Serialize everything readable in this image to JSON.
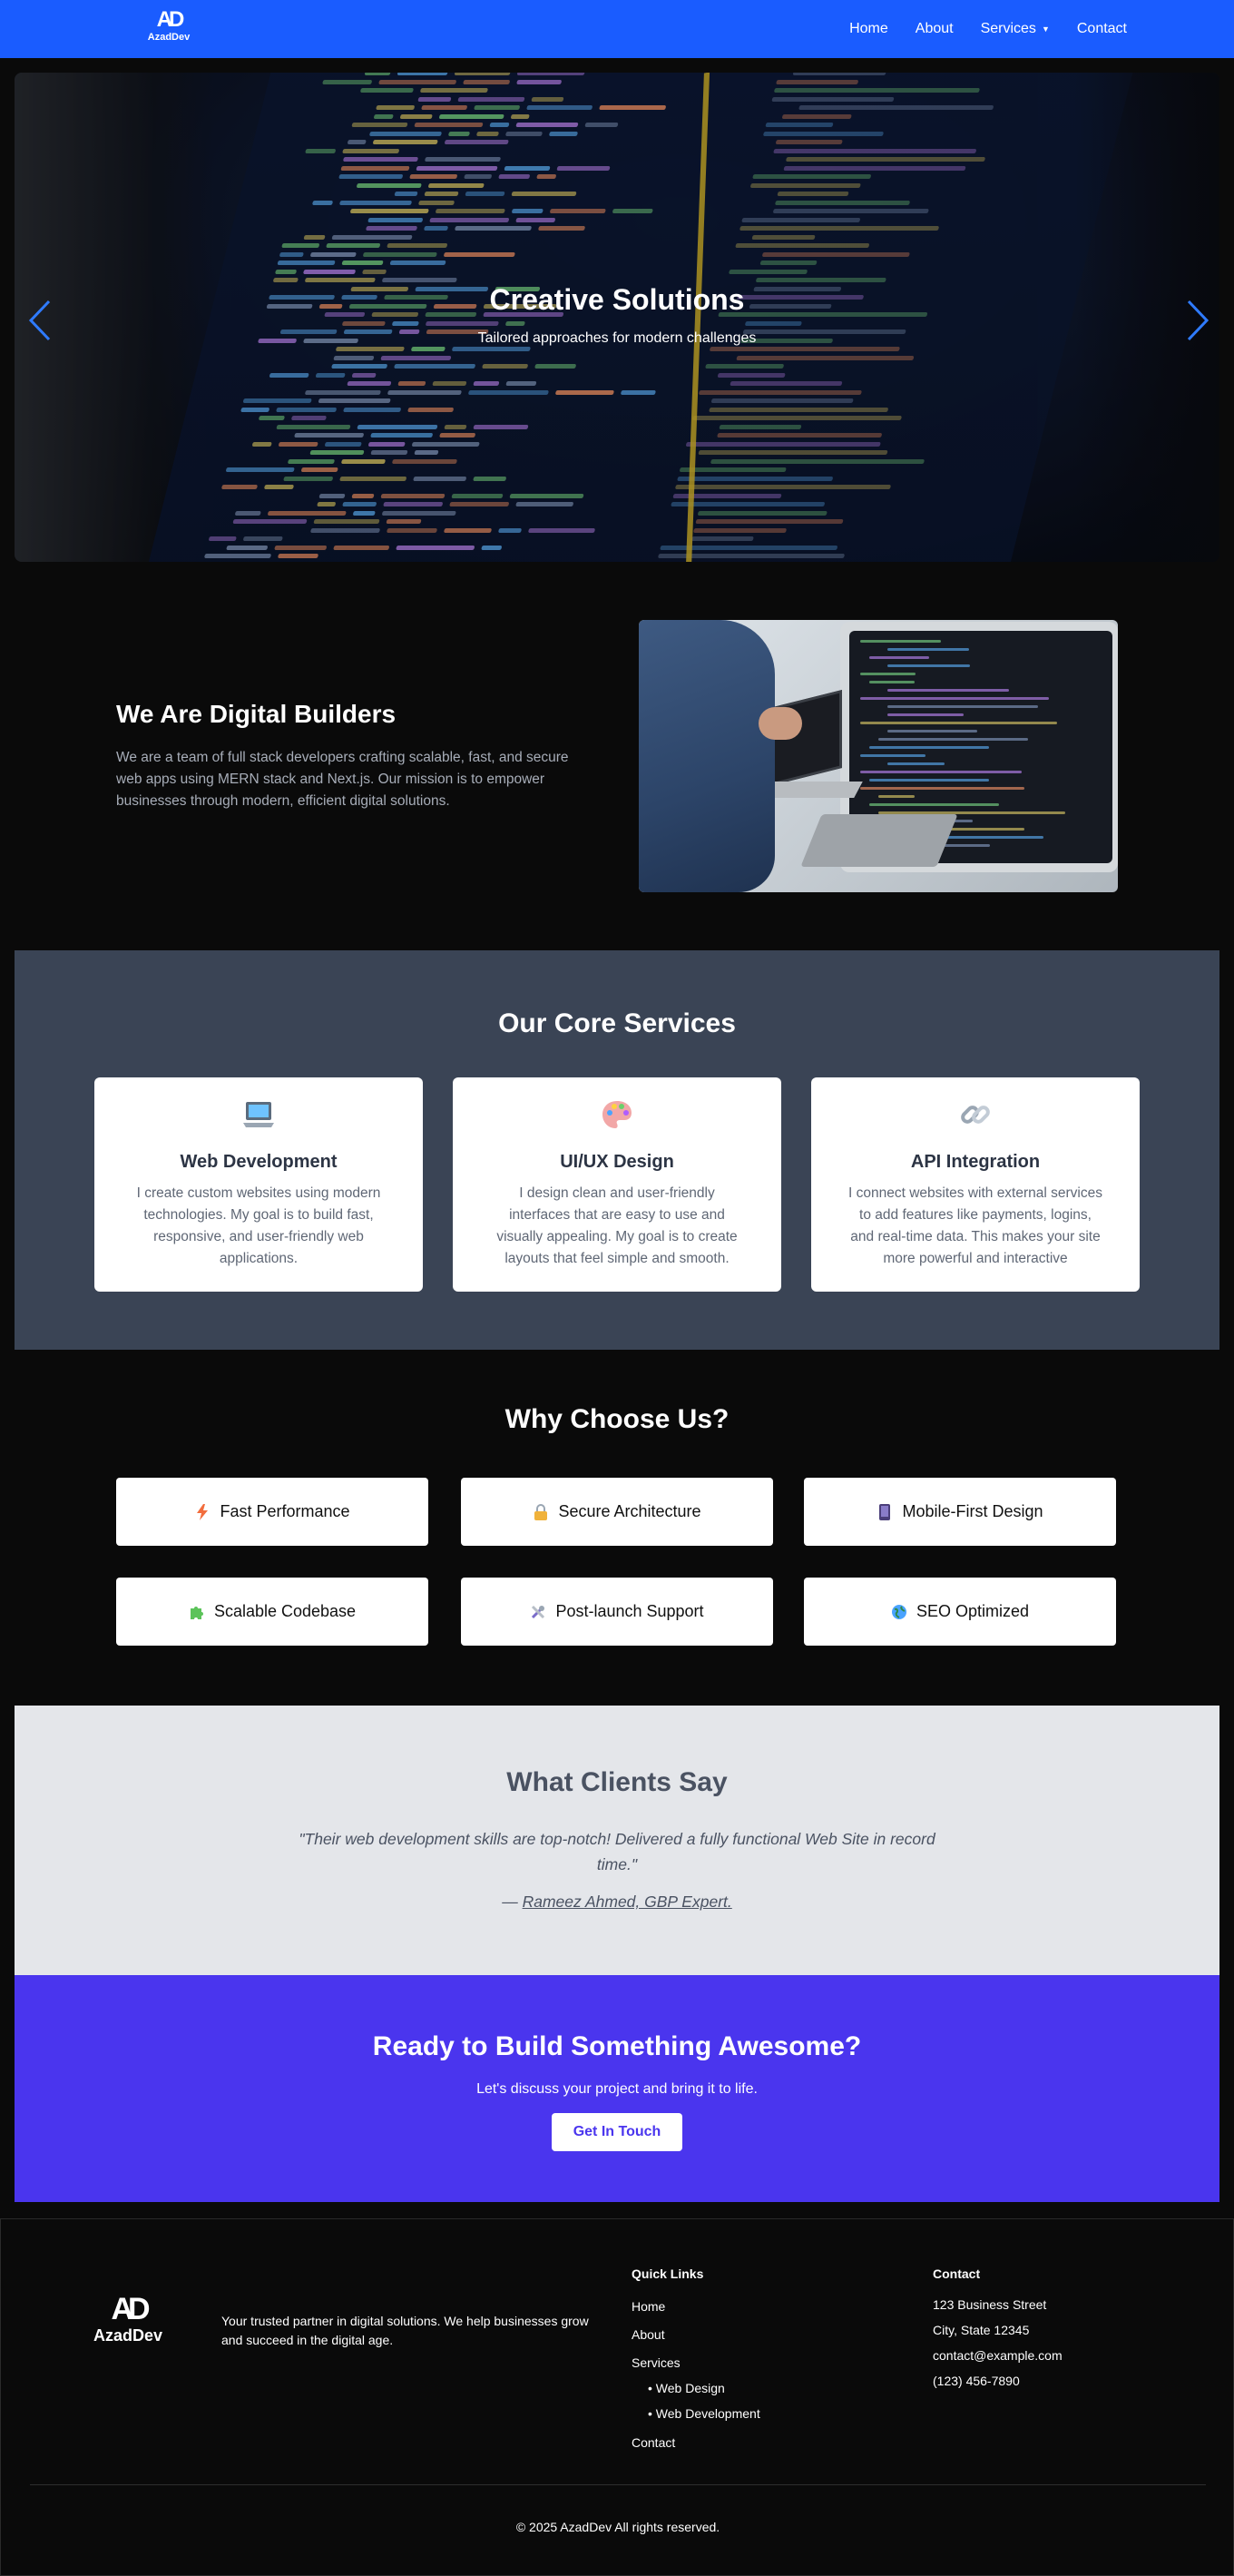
{
  "nav": {
    "logo_mark": "AD",
    "logo_text": "AzadDev",
    "links": [
      "Home",
      "About",
      "Services",
      "Contact"
    ],
    "services_caret": "▼"
  },
  "hero": {
    "title": "Creative Solutions",
    "subtitle": "Tailored approaches for modern challenges",
    "prev_icon": "chevron-left-icon",
    "next_icon": "chevron-right-icon"
  },
  "about": {
    "title": "We Are Digital Builders",
    "text": "We are a team of full stack developers crafting scalable, fast, and secure web apps using MERN stack and Next.js. Our mission is to empower businesses through modern, efficient digital solutions."
  },
  "services": {
    "title": "Our Core Services",
    "cards": [
      {
        "icon": "laptop-icon",
        "title": "Web Development",
        "text": "I create custom websites using modern technologies. My goal is to build fast, responsive, and user-friendly web applications."
      },
      {
        "icon": "palette-icon",
        "title": "UI/UX Design",
        "text": "I design clean and user-friendly interfaces that are easy to use and visually appealing. My goal is to create layouts that feel simple and smooth."
      },
      {
        "icon": "link-icon",
        "title": "API Integration",
        "text": "I connect websites with external services to add features like payments, logins, and real-time data. This makes your site more powerful and interactive"
      }
    ]
  },
  "why": {
    "title": "Why Choose Us?",
    "items": [
      {
        "icon": "lightning-icon",
        "label": "Fast Performance"
      },
      {
        "icon": "lock-icon",
        "label": "Secure Architecture"
      },
      {
        "icon": "mobile-icon",
        "label": "Mobile-First Design"
      },
      {
        "icon": "puzzle-icon",
        "label": "Scalable Codebase"
      },
      {
        "icon": "tools-icon",
        "label": "Post-launch Support"
      },
      {
        "icon": "globe-icon",
        "label": "SEO Optimized"
      }
    ]
  },
  "testimonial": {
    "title": "What Clients Say",
    "quote": "\"Their web development skills are top-notch! Delivered a fully functional Web Site in record time.\"",
    "dash": "— ",
    "author": "Rameez Ahmed, GBP Expert."
  },
  "cta": {
    "title": "Ready to Build Something Awesome?",
    "subtitle": "Let's discuss your project and bring it to life.",
    "button": "Get In Touch"
  },
  "footer": {
    "logo_mark": "AD",
    "logo_text": "AzadDev",
    "description": "Your trusted partner in digital solutions. We help businesses grow and succeed in the digital age.",
    "quick_links_title": "Quick Links",
    "quick_links": [
      "Home",
      "About",
      "Services",
      "• Web Design",
      "• Web Development",
      "Contact"
    ],
    "contact_title": "Contact",
    "contact": [
      "123 Business Street",
      "City, State 12345",
      "contact@example.com",
      "(123) 456-7890"
    ],
    "copyright": "© 2025 AzadDev All rights reserved."
  },
  "colors": {
    "nav_bg": "#1a5cff",
    "services_bg": "#3a4455",
    "testimonial_bg": "#e4e6ea",
    "cta_bg": "#4a35ee",
    "page_bg": "#0a0a0a"
  }
}
